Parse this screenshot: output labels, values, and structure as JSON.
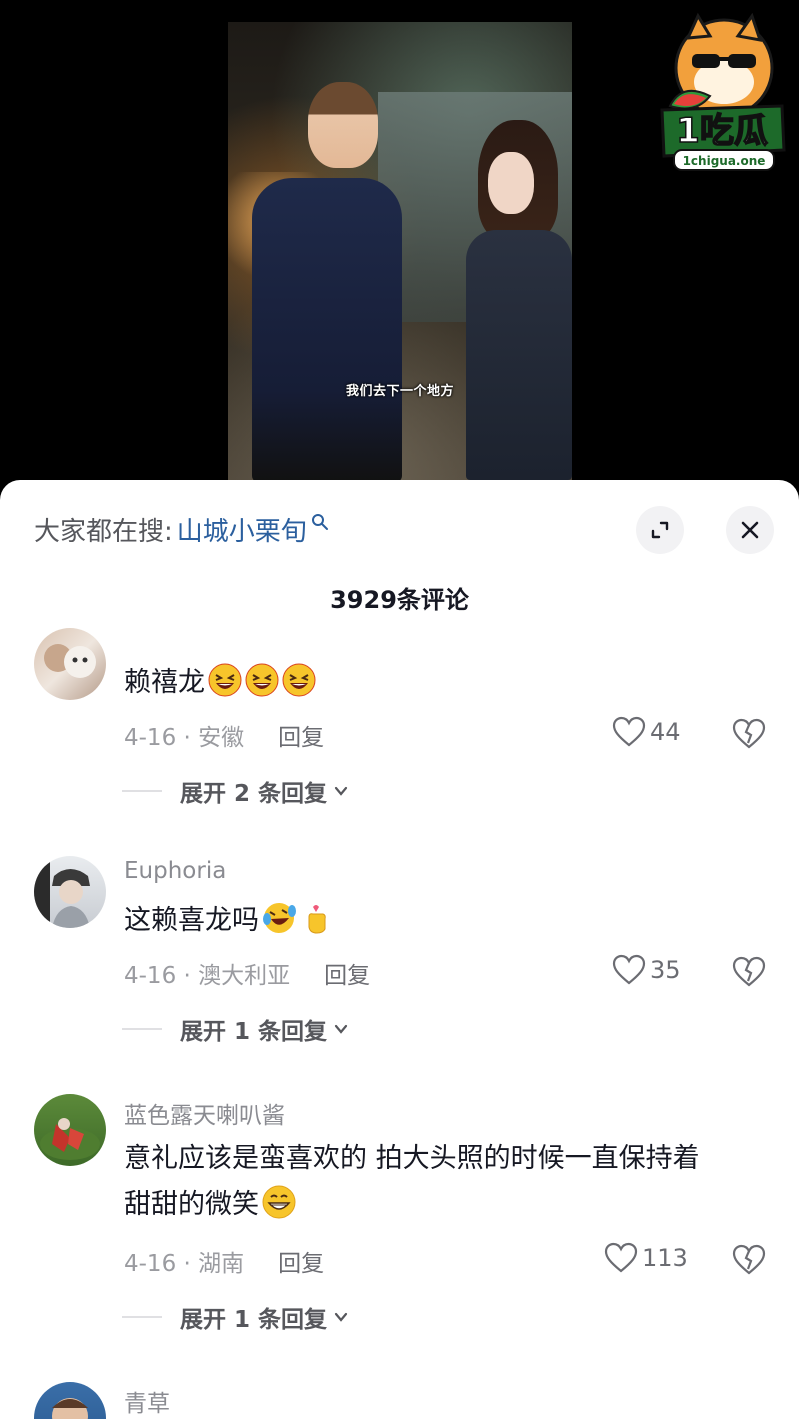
{
  "video": {
    "subtitle": "我们去下一个地方"
  },
  "watermark": {
    "logo_text": "1吃瓜",
    "logo_url_text": "1chigua.one"
  },
  "header": {
    "search_prefix": "大家都在搜:",
    "search_term": "山城小栗旬",
    "comment_count": "3929条评论"
  },
  "comments": [
    {
      "username": "",
      "text": "赖禧龙",
      "emoji_count": 3,
      "date_location": "4-16 · 安徽",
      "reply_label": "回复",
      "likes": "44",
      "expand_label": "展开 2 条回复"
    },
    {
      "username": "Euphoria",
      "text": "这赖喜龙吗",
      "date_location": "4-16 · 澳大利亚",
      "reply_label": "回复",
      "likes": "35",
      "expand_label": "展开 1 条回复"
    },
    {
      "username": "蓝色露天喇叭酱",
      "text_line1": "意礼应该是蛮喜欢的 拍大头照的时候一直保持着",
      "text_line2": "甜甜的微笑",
      "date_location": "4-16 · 湖南",
      "reply_label": "回复",
      "likes": "113",
      "expand_label": "展开 1 条回复"
    },
    {
      "username": "青草"
    }
  ],
  "colors": {
    "search_term": "#2b5f9e",
    "muted_text": "#9a9ba0",
    "primary_text": "#161823",
    "emoji_yellow": "#f7c52b"
  }
}
